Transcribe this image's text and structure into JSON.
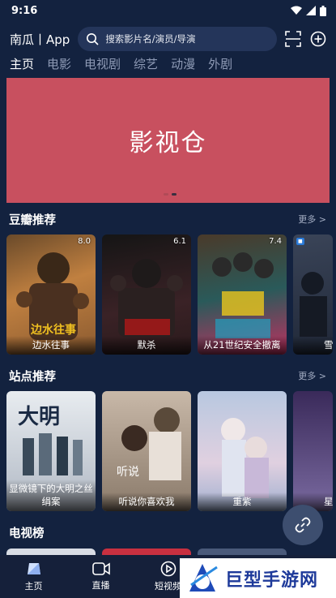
{
  "status_bar": {
    "time": "9:16"
  },
  "header": {
    "app_title": "南瓜丨App",
    "search_placeholder": "搜索影片名/演员/导演"
  },
  "tabs": [
    "主页",
    "电影",
    "电视剧",
    "综艺",
    "动漫",
    "外剧"
  ],
  "active_tab": "主页",
  "banner": {
    "title": "影视仓",
    "color": "#c8505f"
  },
  "sections": {
    "douban": {
      "title": "豆瓣推荐",
      "more": "更多 >",
      "items": [
        {
          "title": "边水往事",
          "score": "8.0",
          "color": "#b0703a"
        },
        {
          "title": "默杀",
          "score": "6.1",
          "color": "#3a2226"
        },
        {
          "title": "从21世纪安全撤离",
          "score": "7.4",
          "color": "#1e4a4a"
        },
        {
          "title": "雪",
          "score": "",
          "color": "#2a3344"
        }
      ]
    },
    "site": {
      "title": "站点推荐",
      "more": "更多 >",
      "items": [
        {
          "title": "显微镜下的大明之丝绢案",
          "color": "#c7ccd4"
        },
        {
          "title": "听说你喜欢我",
          "color": "#a99a8a"
        },
        {
          "title": "重紫",
          "color": "#8aa0c8"
        },
        {
          "title": "星落",
          "color": "#5a4a7a"
        }
      ]
    },
    "tv": {
      "title": "电视榜"
    }
  },
  "bottom_nav": [
    "主页",
    "直播",
    "短视频"
  ],
  "watermark": {
    "text": "巨型手游网"
  },
  "colors": {
    "background": "#13223f",
    "search_bg": "#24355a",
    "tab_inactive": "#8e9ab5"
  }
}
